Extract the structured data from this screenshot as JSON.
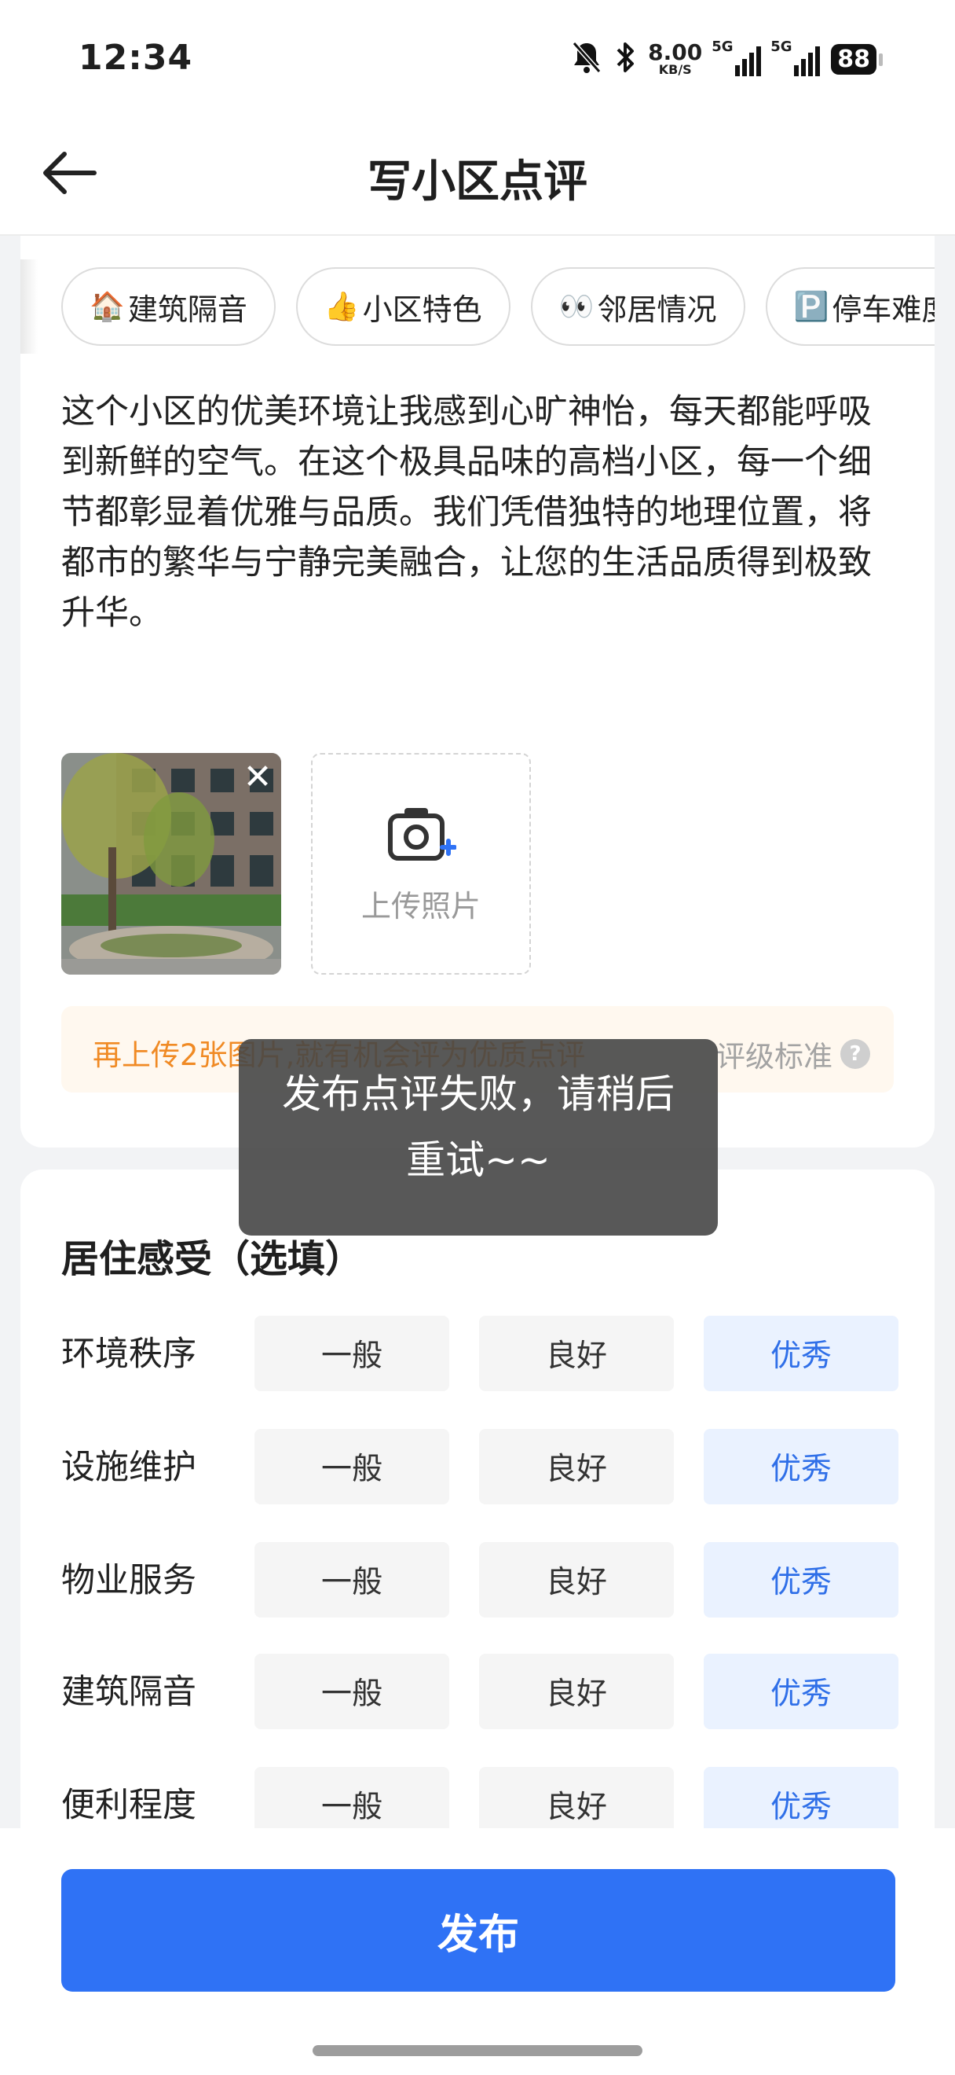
{
  "status_bar": {
    "time": "12:34",
    "net_speed_value": "8.00",
    "net_speed_unit": "KB/S",
    "signal1_label": "5G",
    "signal2_label": "5G",
    "battery": "88",
    "icons": [
      "mute-bell-icon",
      "bluetooth-icon",
      "signal-icon",
      "signal-icon",
      "battery-icon"
    ]
  },
  "nav": {
    "title": "写小区点评",
    "back_icon": "back-arrow-icon"
  },
  "tags": [
    {
      "emoji": "🏠",
      "label": "建筑隔音"
    },
    {
      "emoji": "👍",
      "label": "小区特色"
    },
    {
      "emoji": "👀",
      "label": "邻居情况"
    },
    {
      "emoji": "🅿️",
      "label": "停车难度"
    }
  ],
  "review": {
    "text": "这个小区的优美环境让我感到心旷神怡，每天都能呼吸到新鲜的空气。在这个极具品味的高档小区，每一个细节都彰显着优雅与品质。我们凭借独特的地理位置，将都市的繁华与宁静完美融合，让您的生活品质得到极致升华。"
  },
  "photos": {
    "remove_symbol": "✕",
    "upload_label": "上传照片"
  },
  "tip": {
    "text": "再上传2张图片,就有机会评为优质点评",
    "rating_standard": "评级标准",
    "help_symbol": "?"
  },
  "living": {
    "title": "居住感受（选填）",
    "options": [
      "一般",
      "良好",
      "优秀"
    ],
    "rows": [
      {
        "label": "环境秩序",
        "selected": "优秀"
      },
      {
        "label": "设施维护",
        "selected": "优秀"
      },
      {
        "label": "物业服务",
        "selected": "优秀"
      },
      {
        "label": "建筑隔音",
        "selected": "优秀"
      },
      {
        "label": "便利程度",
        "selected": "优秀"
      }
    ]
  },
  "publish_label": "发布",
  "toast": "发布点评失败，请稍后重试~~",
  "colors": {
    "accent": "#2f72f5",
    "selected_bg": "#eaf2ff",
    "selected_text": "#2f6fe8",
    "tip_text": "#f08a24"
  }
}
